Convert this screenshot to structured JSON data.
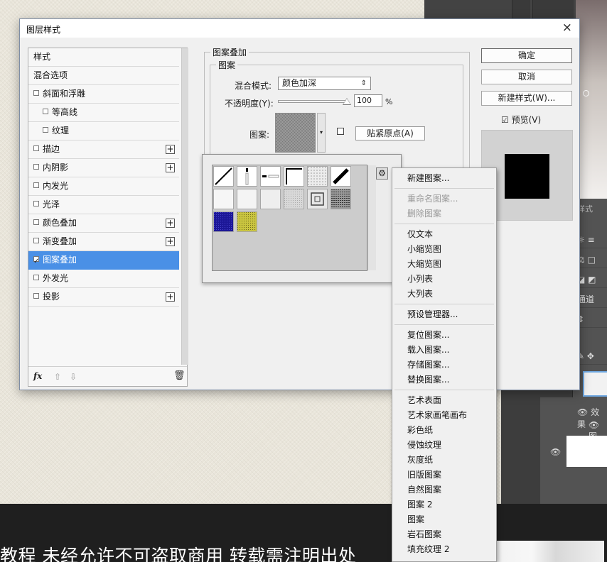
{
  "dialog": {
    "title": "图层样式",
    "close_label": "×",
    "styles_list": [
      {
        "label": "样式",
        "checkbox": false,
        "checked": false,
        "plus": false,
        "selected": false
      },
      {
        "label": "混合选项",
        "checkbox": false,
        "checked": false,
        "plus": false,
        "selected": false
      },
      {
        "label": "斜面和浮雕",
        "checkbox": true,
        "checked": false,
        "plus": false,
        "selected": false
      },
      {
        "label": "等高线",
        "checkbox": true,
        "checked": false,
        "plus": false,
        "selected": false,
        "indent": true
      },
      {
        "label": "纹理",
        "checkbox": true,
        "checked": false,
        "plus": false,
        "selected": false,
        "indent": true
      },
      {
        "label": "描边",
        "checkbox": true,
        "checked": false,
        "plus": true,
        "selected": false
      },
      {
        "label": "内阴影",
        "checkbox": true,
        "checked": false,
        "plus": true,
        "selected": false
      },
      {
        "label": "内发光",
        "checkbox": true,
        "checked": false,
        "plus": false,
        "selected": false
      },
      {
        "label": "光泽",
        "checkbox": true,
        "checked": false,
        "plus": false,
        "selected": false
      },
      {
        "label": "颜色叠加",
        "checkbox": true,
        "checked": false,
        "plus": true,
        "selected": false
      },
      {
        "label": "渐变叠加",
        "checkbox": true,
        "checked": false,
        "plus": true,
        "selected": false
      },
      {
        "label": "图案叠加",
        "checkbox": true,
        "checked": true,
        "plus": false,
        "selected": true
      },
      {
        "label": "外发光",
        "checkbox": true,
        "checked": false,
        "plus": false,
        "selected": false
      },
      {
        "label": "投影",
        "checkbox": true,
        "checked": false,
        "plus": true,
        "selected": false
      }
    ],
    "footer": {
      "fx": "fx",
      "up": "⇧",
      "down": "⇩",
      "trash": "🗑"
    },
    "pattern_overlay": {
      "group_title": "图案叠加",
      "subgroup_title": "图案",
      "blend_mode_label": "混合模式:",
      "blend_mode_value": "颜色加深",
      "opacity_label": "不透明度(Y):",
      "opacity_value": "100",
      "opacity_unit": "%",
      "pattern_label": "图案:",
      "snap_button": "贴紧原点(A)"
    },
    "buttons": {
      "ok": "确定",
      "cancel": "取消",
      "new_style": "新建样式(W)...",
      "preview": "预览(V)"
    },
    "preview_checked": true
  },
  "pattern_picker": {
    "tiles": [
      {
        "kind": "diag-line",
        "bg": "#ffffff"
      },
      {
        "kind": "dot-vert",
        "bg": "#ffffff"
      },
      {
        "kind": "dash",
        "bg": "#ffffff"
      },
      {
        "kind": "corner",
        "bg": "#ffffff"
      },
      {
        "kind": "noise-light",
        "bg": "#ececec"
      },
      {
        "kind": "diag-thick",
        "bg": "#ffffff"
      },
      {
        "kind": "blank",
        "bg": "#f6f6f6"
      },
      {
        "kind": "blank",
        "bg": "#f4f4f4"
      },
      {
        "kind": "blank",
        "bg": "#eeeeee"
      },
      {
        "kind": "texture-gray",
        "bg": "#d8d8d8"
      },
      {
        "kind": "frame",
        "bg": "#e6e6e6"
      },
      {
        "kind": "texture-dark",
        "bg": "#9a9a9a"
      },
      {
        "kind": "blue",
        "bg": "#1c1797"
      },
      {
        "kind": "yellow",
        "bg": "#c9c43f"
      }
    ],
    "gear_icon": "⚙"
  },
  "context_menu": {
    "items": [
      {
        "label": "新建图案...",
        "disabled": false
      },
      {
        "separator": true
      },
      {
        "label": "重命名图案...",
        "disabled": true
      },
      {
        "label": "删除图案",
        "disabled": true
      },
      {
        "separator": true
      },
      {
        "label": "仅文本",
        "disabled": false
      },
      {
        "label": "小缩览图",
        "disabled": false
      },
      {
        "label": "大缩览图",
        "disabled": false
      },
      {
        "label": "小列表",
        "disabled": false
      },
      {
        "label": "大列表",
        "disabled": false
      },
      {
        "separator": true
      },
      {
        "label": "预设管理器...",
        "disabled": false
      },
      {
        "separator": true
      },
      {
        "label": "复位图案...",
        "disabled": false
      },
      {
        "label": "载入图案...",
        "disabled": false
      },
      {
        "label": "存储图案...",
        "disabled": false
      },
      {
        "label": "替换图案...",
        "disabled": false
      },
      {
        "separator": true
      },
      {
        "label": "艺术表面",
        "disabled": false
      },
      {
        "label": "艺术家画笔画布",
        "disabled": false
      },
      {
        "label": "彩色纸",
        "disabled": false
      },
      {
        "label": "侵蚀纹理",
        "disabled": false
      },
      {
        "label": "灰度纸",
        "disabled": false
      },
      {
        "label": "旧版图案",
        "disabled": false
      },
      {
        "label": "自然图案",
        "disabled": false
      },
      {
        "label": "图案 2",
        "disabled": false
      },
      {
        "label": "图案",
        "disabled": false
      },
      {
        "label": "岩石图案",
        "disabled": false
      },
      {
        "label": "填充纹理 2",
        "disabled": false
      }
    ]
  },
  "workspace": {
    "panel_tab": "样式",
    "channels_tab": "通道",
    "effects_label": "效果",
    "pattern_label": "图"
  },
  "watermark_text": "教程 未经允许不可盗取商用 转载需注明出处",
  "colors": {
    "selection": "#4a90e6",
    "workspace": "#535353",
    "caption_bar": "#1f1f1f"
  }
}
